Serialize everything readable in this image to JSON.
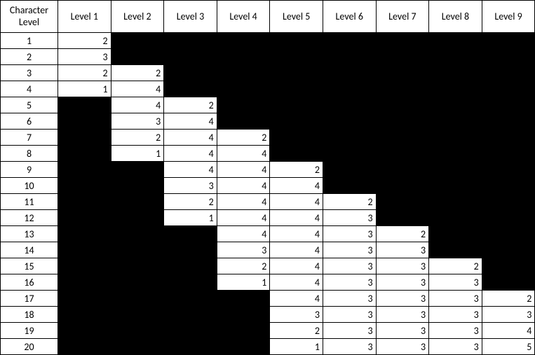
{
  "header": {
    "character_level": "Character Level",
    "levels": [
      "Level 1",
      "Level 2",
      "Level 3",
      "Level 4",
      "Level 5",
      "Level 6",
      "Level 7",
      "Level 8",
      "Level 9"
    ]
  },
  "rows": [
    {
      "cl": "1",
      "v": [
        "2",
        null,
        null,
        null,
        null,
        null,
        null,
        null,
        null
      ]
    },
    {
      "cl": "2",
      "v": [
        "3",
        null,
        null,
        null,
        null,
        null,
        null,
        null,
        null
      ]
    },
    {
      "cl": "3",
      "v": [
        "2",
        "2",
        null,
        null,
        null,
        null,
        null,
        null,
        null
      ]
    },
    {
      "cl": "4",
      "v": [
        "1",
        "4",
        null,
        null,
        null,
        null,
        null,
        null,
        null
      ]
    },
    {
      "cl": "5",
      "v": [
        null,
        "4",
        "2",
        null,
        null,
        null,
        null,
        null,
        null
      ]
    },
    {
      "cl": "6",
      "v": [
        null,
        "3",
        "4",
        null,
        null,
        null,
        null,
        null,
        null
      ]
    },
    {
      "cl": "7",
      "v": [
        null,
        "2",
        "4",
        "2",
        null,
        null,
        null,
        null,
        null
      ]
    },
    {
      "cl": "8",
      "v": [
        null,
        "1",
        "4",
        "4",
        null,
        null,
        null,
        null,
        null
      ]
    },
    {
      "cl": "9",
      "v": [
        null,
        null,
        "4",
        "4",
        "2",
        null,
        null,
        null,
        null
      ]
    },
    {
      "cl": "10",
      "v": [
        null,
        null,
        "3",
        "4",
        "4",
        null,
        null,
        null,
        null
      ]
    },
    {
      "cl": "11",
      "v": [
        null,
        null,
        "2",
        "4",
        "4",
        "2",
        null,
        null,
        null
      ]
    },
    {
      "cl": "12",
      "v": [
        null,
        null,
        "1",
        "4",
        "4",
        "3",
        null,
        null,
        null
      ]
    },
    {
      "cl": "13",
      "v": [
        null,
        null,
        null,
        "4",
        "4",
        "3",
        "2",
        null,
        null
      ]
    },
    {
      "cl": "14",
      "v": [
        null,
        null,
        null,
        "3",
        "4",
        "3",
        "3",
        null,
        null
      ]
    },
    {
      "cl": "15",
      "v": [
        null,
        null,
        null,
        "2",
        "4",
        "3",
        "3",
        "2",
        null
      ]
    },
    {
      "cl": "16",
      "v": [
        null,
        null,
        null,
        "1",
        "4",
        "3",
        "3",
        "3",
        null
      ]
    },
    {
      "cl": "17",
      "v": [
        null,
        null,
        null,
        null,
        "4",
        "3",
        "3",
        "3",
        "2"
      ]
    },
    {
      "cl": "18",
      "v": [
        null,
        null,
        null,
        null,
        "3",
        "3",
        "3",
        "3",
        "3"
      ]
    },
    {
      "cl": "19",
      "v": [
        null,
        null,
        null,
        null,
        "2",
        "3",
        "3",
        "3",
        "4"
      ]
    },
    {
      "cl": "20",
      "v": [
        null,
        null,
        null,
        null,
        "1",
        "3",
        "3",
        "3",
        "5"
      ]
    }
  ],
  "chart_data": {
    "type": "table",
    "title": "",
    "row_label": "Character Level",
    "columns": [
      "Level 1",
      "Level 2",
      "Level 3",
      "Level 4",
      "Level 5",
      "Level 6",
      "Level 7",
      "Level 8",
      "Level 9"
    ],
    "index": [
      1,
      2,
      3,
      4,
      5,
      6,
      7,
      8,
      9,
      10,
      11,
      12,
      13,
      14,
      15,
      16,
      17,
      18,
      19,
      20
    ],
    "values": [
      [
        2,
        null,
        null,
        null,
        null,
        null,
        null,
        null,
        null
      ],
      [
        3,
        null,
        null,
        null,
        null,
        null,
        null,
        null,
        null
      ],
      [
        2,
        2,
        null,
        null,
        null,
        null,
        null,
        null,
        null
      ],
      [
        1,
        4,
        null,
        null,
        null,
        null,
        null,
        null,
        null
      ],
      [
        null,
        4,
        2,
        null,
        null,
        null,
        null,
        null,
        null
      ],
      [
        null,
        3,
        4,
        null,
        null,
        null,
        null,
        null,
        null
      ],
      [
        null,
        2,
        4,
        2,
        null,
        null,
        null,
        null,
        null
      ],
      [
        null,
        1,
        4,
        4,
        null,
        null,
        null,
        null,
        null
      ],
      [
        null,
        null,
        4,
        4,
        2,
        null,
        null,
        null,
        null
      ],
      [
        null,
        null,
        3,
        4,
        4,
        null,
        null,
        null,
        null
      ],
      [
        null,
        null,
        2,
        4,
        4,
        2,
        null,
        null,
        null
      ],
      [
        null,
        null,
        1,
        4,
        4,
        3,
        null,
        null,
        null
      ],
      [
        null,
        null,
        null,
        4,
        4,
        3,
        2,
        null,
        null
      ],
      [
        null,
        null,
        null,
        3,
        4,
        3,
        3,
        null,
        null
      ],
      [
        null,
        null,
        null,
        2,
        4,
        3,
        3,
        2,
        null
      ],
      [
        null,
        null,
        null,
        1,
        4,
        3,
        3,
        3,
        null
      ],
      [
        null,
        null,
        null,
        null,
        4,
        3,
        3,
        3,
        2
      ],
      [
        null,
        null,
        null,
        null,
        3,
        3,
        3,
        3,
        3
      ],
      [
        null,
        null,
        null,
        null,
        2,
        3,
        3,
        3,
        4
      ],
      [
        null,
        null,
        null,
        null,
        1,
        3,
        3,
        3,
        5
      ]
    ]
  }
}
